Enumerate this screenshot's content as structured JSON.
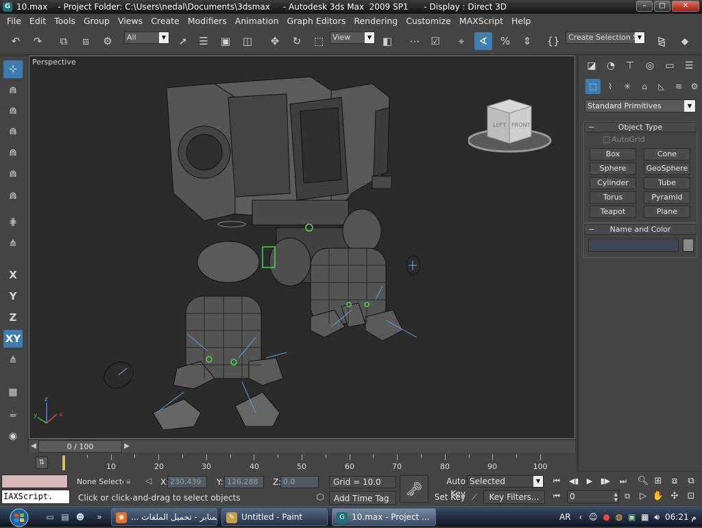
{
  "window": {
    "title": "10.max    - Project Folder: C:\\Users\\nedal\\Documents\\3dsmax     - Autodesk 3ds Max  2009 SP1      - Display : Direct 3D",
    "minimize": "–",
    "maximize": "□",
    "close": "✕"
  },
  "menu": [
    "File",
    "Edit",
    "Tools",
    "Group",
    "Views",
    "Create",
    "Modifiers",
    "Animation",
    "Graph Editors",
    "Rendering",
    "Customize",
    "MAXScript",
    "Help"
  ],
  "toolbar": {
    "selection_filter": "All",
    "reference_coord": "View",
    "named_selection_placeholder": "Create Selection Se"
  },
  "axis_buttons": [
    "X",
    "Y",
    "Z",
    "XY"
  ],
  "viewport": {
    "label": "Perspective",
    "viewcube_left": "LEFT",
    "viewcube_front": "FRONT"
  },
  "time_slider": {
    "current": 0,
    "total": 100,
    "label": "0 / 100"
  },
  "trackbar": {
    "labels": [
      "10",
      "20",
      "30",
      "40",
      "50",
      "60",
      "70",
      "80",
      "90",
      "100"
    ]
  },
  "command_panel": {
    "category": "Standard Primitives",
    "object_type_title": "Object Type",
    "autogrid_label": "AutoGrid",
    "primitives": [
      "Box",
      "Cone",
      "Sphere",
      "GeoSphere",
      "Cylinder",
      "Tube",
      "Torus",
      "Pyramid",
      "Teapot",
      "Plane"
    ],
    "name_color_title": "Name and Color"
  },
  "status": {
    "maxscript": "IAXScript.",
    "selection": "None Selecte",
    "x_label": "X:",
    "x_value": "230.439",
    "y_label": "Y:",
    "y_value": "126.288",
    "z_label": "Z:",
    "z_value": "0.0",
    "grid": "Grid = 10.0",
    "prompt": "Click or click-and-drag to select objects",
    "add_time_tag": "Add Time Tag",
    "auto_key": "Auto Key",
    "set_key": "Set Key",
    "key_mode": "Selected",
    "key_filters": "Key Filters...",
    "frame": "0"
  },
  "taskbar": {
    "items": [
      {
        "label": "... المنابر - تحميل الملفات",
        "icon": "firefox-icon"
      },
      {
        "label": "Untitled - Paint",
        "icon": "paint-icon"
      },
      {
        "label": "10.max    - Project ...",
        "icon": "3dsmax-icon"
      }
    ],
    "language": "AR",
    "time": "06:21 م",
    "expand": "»"
  },
  "colors": {
    "ui_background": "#444444",
    "viewport_background": "#2b2b2b",
    "active_button": "#3d7bb0",
    "selection_highlight": "#44dd44"
  }
}
